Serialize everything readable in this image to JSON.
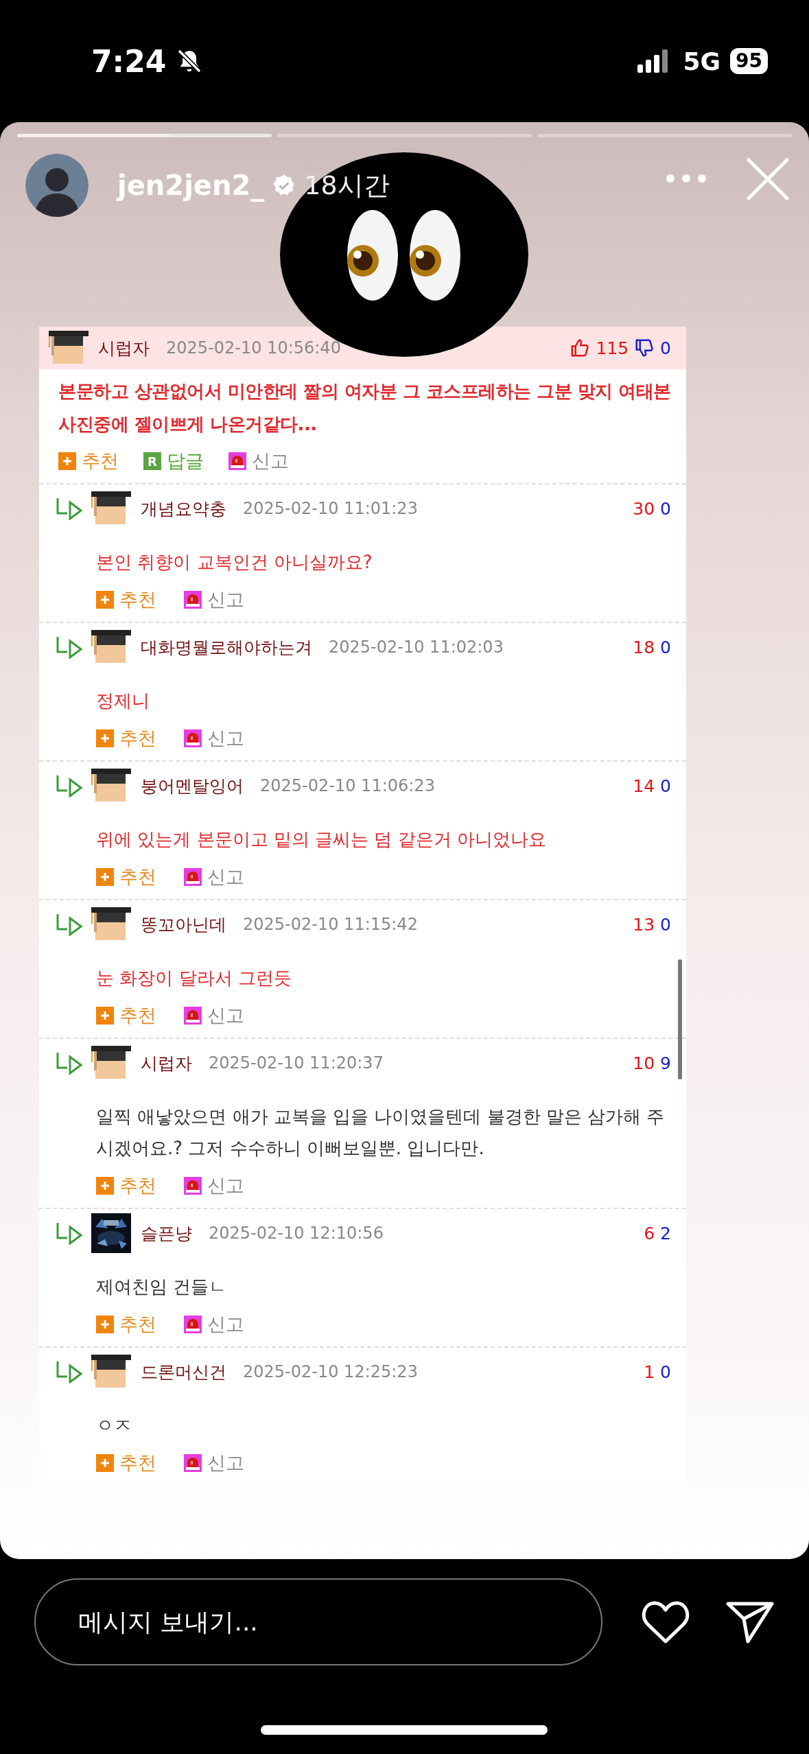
{
  "status_bar": {
    "time": "7:24",
    "network": "5G",
    "battery": "95"
  },
  "story": {
    "progress": [
      {
        "current": true,
        "level": 0.6
      },
      {
        "current": false
      },
      {
        "current": false
      }
    ],
    "username": "jen2jen2_",
    "verified": true,
    "time": "18시간",
    "comments": [
      {
        "kind": "main",
        "avatar": {
          "kind": "figure"
        },
        "author": "시럽자",
        "date": "2025-02-10 10:56:40",
        "likes": "115",
        "dislikes": "0",
        "highlighted": true,
        "text": "본문하고 상관없어서 미안한데 짤의 여자분 그 코스프레하는 그분 맞지 여태본 사진중에 젤이쁘게 나온거같다...",
        "actions": [
          {
            "kind": "recommend",
            "label": "추천"
          },
          {
            "kind": "reply",
            "icon_text": "R",
            "label": "답글"
          },
          {
            "kind": "report",
            "label": "신고"
          }
        ]
      },
      {
        "kind": "reply",
        "avatar": {
          "kind": "figure"
        },
        "author": "개념요약충",
        "date": "2025-02-10 11:01:23",
        "likes": "30",
        "dislikes": "0",
        "highlighted": true,
        "text": "본인 취향이 교복인건 아니실까요?",
        "actions": [
          {
            "kind": "recommend",
            "label": "추천"
          },
          {
            "kind": "report",
            "label": "신고"
          }
        ]
      },
      {
        "kind": "reply",
        "avatar": {
          "kind": "figure"
        },
        "author": "대화명뭘로해야하는겨",
        "date": "2025-02-10 11:02:03",
        "likes": "18",
        "dislikes": "0",
        "highlighted": true,
        "text": "정제니",
        "actions": [
          {
            "kind": "recommend",
            "label": "추천"
          },
          {
            "kind": "report",
            "label": "신고"
          }
        ]
      },
      {
        "kind": "reply",
        "avatar": {
          "kind": "figure"
        },
        "author": "붕어멘탈잉어",
        "date": "2025-02-10 11:06:23",
        "likes": "14",
        "dislikes": "0",
        "highlighted": true,
        "text": "위에 있는게 본문이고 밑의 글씨는 덤 같은거 아니었나요",
        "actions": [
          {
            "kind": "recommend",
            "label": "추천"
          },
          {
            "kind": "report",
            "label": "신고"
          }
        ]
      },
      {
        "kind": "reply",
        "avatar": {
          "kind": "figure"
        },
        "author": "똥꼬아닌데",
        "date": "2025-02-10 11:15:42",
        "likes": "13",
        "dislikes": "0",
        "highlighted": true,
        "text": "눈 화장이 달라서 그런듯",
        "actions": [
          {
            "kind": "recommend",
            "label": "추천"
          },
          {
            "kind": "report",
            "label": "신고"
          }
        ]
      },
      {
        "kind": "reply",
        "avatar": {
          "kind": "figure"
        },
        "author": "시럽자",
        "date": "2025-02-10 11:20:37",
        "likes": "10",
        "dislikes": "9",
        "highlighted": false,
        "text": "일찍 애낳았으면 애가 교복을 입을 나이였을텐데 불경한 말은 삼가해 주시겠어요.? 그저 수수하니 이뻐보일뿐. 입니다만.",
        "actions": [
          {
            "kind": "recommend",
            "label": "추천"
          },
          {
            "kind": "report",
            "label": "신고"
          }
        ]
      },
      {
        "kind": "reply",
        "avatar": {
          "kind": "picture"
        },
        "author": "슬픈냥",
        "date": "2025-02-10 12:10:56",
        "likes": "6",
        "dislikes": "2",
        "highlighted": false,
        "text": "제여친임 건들ㄴ",
        "actions": [
          {
            "kind": "recommend",
            "label": "추천"
          },
          {
            "kind": "report",
            "label": "신고"
          }
        ]
      },
      {
        "kind": "reply",
        "avatar": {
          "kind": "figure"
        },
        "author": "드론머신건",
        "date": "2025-02-10 12:25:23",
        "likes": "1",
        "dislikes": "0",
        "highlighted": false,
        "text": "ㅇㅈ",
        "actions": [
          {
            "kind": "recommend",
            "label": "추천"
          },
          {
            "kind": "report",
            "label": "신고"
          }
        ]
      }
    ]
  },
  "message_bar": {
    "placeholder": "메시지 보내기..."
  }
}
